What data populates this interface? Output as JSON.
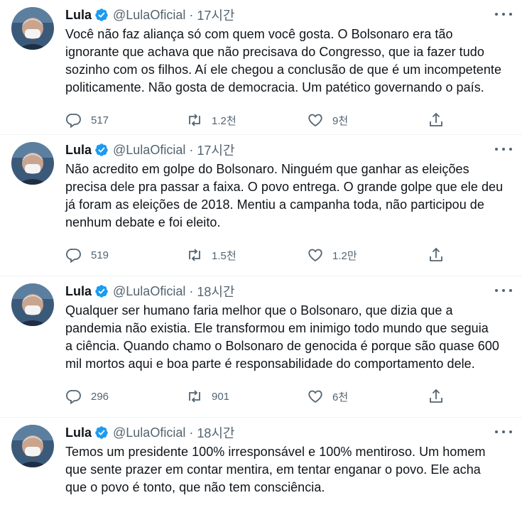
{
  "tweets": [
    {
      "name": "Lula",
      "handle": "@LulaOficial",
      "separator": "·",
      "time": "17시간",
      "lines": [
        "Você não faz aliança só com quem você gosta. O Bolsonaro era tão",
        "ignorante que achava que não precisava do Congresso, que ia fazer tudo",
        "sozinho com os filhos. Aí ele chegou a conclusão de que é um incompetente",
        "politicamente. Não gosta de democracia. Um patético governando o país."
      ],
      "replies": "517",
      "retweets": "1.2천",
      "likes": "9천"
    },
    {
      "name": "Lula",
      "handle": "@LulaOficial",
      "separator": "·",
      "time": "17시간",
      "lines": [
        "Não acredito em golpe do Bolsonaro. Ninguém que ganhar as eleições",
        "precisa dele pra passar a faixa. O povo entrega. O grande golpe que ele deu",
        "já foram as eleições de 2018. Mentiu a campanha toda, não participou de",
        "nenhum debate e foi eleito."
      ],
      "replies": "519",
      "retweets": "1.5천",
      "likes": "1.2만"
    },
    {
      "name": "Lula",
      "handle": "@LulaOficial",
      "separator": "·",
      "time": "18시간",
      "lines": [
        "Qualquer ser humano faria melhor que o Bolsonaro, que dizia que a",
        "pandemia não existia. Ele transformou em inimigo todo mundo que seguia",
        "a ciência. Quando chamo o Bolsonaro de genocida é porque são quase 600",
        "mil mortos aqui e boa parte é responsabilidade do comportamento dele."
      ],
      "replies": "296",
      "retweets": "901",
      "likes": "6천"
    },
    {
      "name": "Lula",
      "handle": "@LulaOficial",
      "separator": "·",
      "time": "18시간",
      "lines": [
        "Temos um presidente 100% irresponsável e 100% mentiroso. Um homem",
        "que sente prazer em contar mentira, em tentar enganar o povo. Ele acha",
        "que o povo é tonto, que não tem consciência."
      ]
    }
  ],
  "icons": {
    "verified": "verified-badge-icon",
    "more": "more-options-icon",
    "reply": "reply-icon",
    "retweet": "retweet-icon",
    "like": "heart-icon",
    "share": "share-icon"
  },
  "colors": {
    "verified": "#1d9bf0",
    "secondary_text": "#536471",
    "primary_text": "#0f1419",
    "divider": "#eff3f4"
  }
}
